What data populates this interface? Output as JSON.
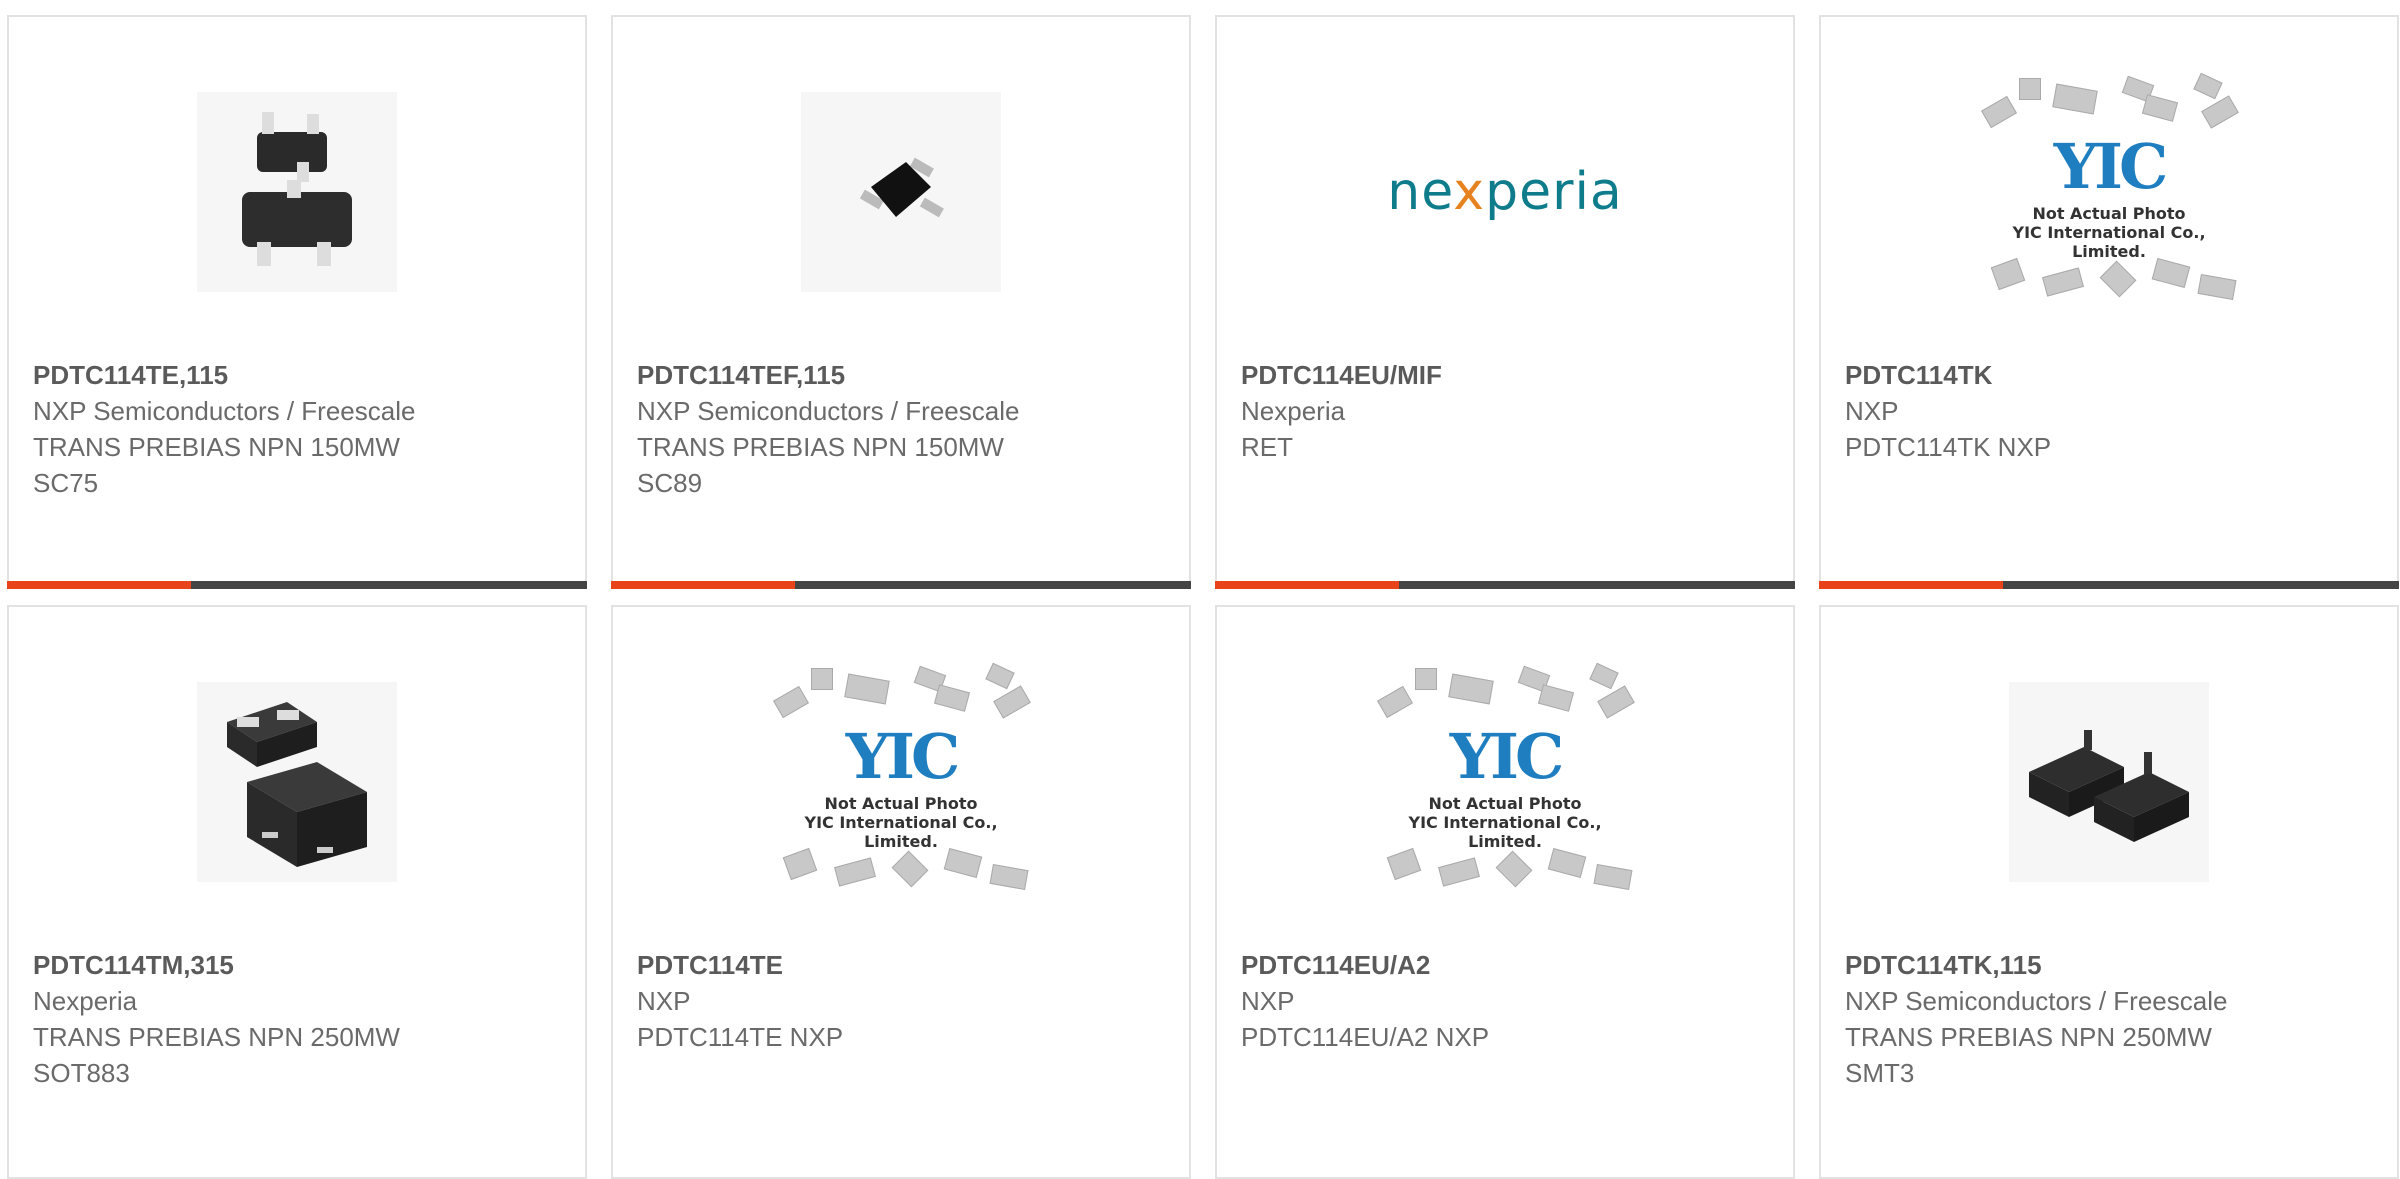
{
  "colors": {
    "accent": "#e8431b",
    "bar": "#444444",
    "border": "#e2e2e2"
  },
  "products": [
    {
      "part": "PDTC114TE,115",
      "maker": "NXP Semiconductors / Freescale",
      "desc": "TRANS PREBIAS NPN 150MW",
      "pkg": "SC75",
      "image": "component-photo"
    },
    {
      "part": "PDTC114TEF,115",
      "maker": "NXP Semiconductors / Freescale",
      "desc": "TRANS PREBIAS NPN 150MW",
      "pkg": "SC89",
      "image": "component-photo"
    },
    {
      "part": "PDTC114EU/MIF",
      "maker": "Nexperia",
      "desc": "RET",
      "pkg": "",
      "image": "nexperia-logo",
      "logo_text_a": "ne",
      "logo_text_x": "x",
      "logo_text_b": "peria"
    },
    {
      "part": "PDTC114TK",
      "maker": "NXP",
      "desc": "PDTC114TK NXP",
      "pkg": "",
      "image": "yic-placeholder"
    },
    {
      "part": "PDTC114TM,315",
      "maker": "Nexperia",
      "desc": "TRANS PREBIAS NPN 250MW",
      "pkg": "SOT883",
      "image": "component-photo"
    },
    {
      "part": "PDTC114TE",
      "maker": "NXP",
      "desc": "PDTC114TE NXP",
      "pkg": "",
      "image": "yic-placeholder"
    },
    {
      "part": "PDTC114EU/A2",
      "maker": "NXP",
      "desc": "PDTC114EU/A2 NXP",
      "pkg": "",
      "image": "yic-placeholder"
    },
    {
      "part": "PDTC114TK,115",
      "maker": "NXP Semiconductors / Freescale",
      "desc": "TRANS PREBIAS NPN 250MW",
      "pkg": "SMT3",
      "image": "component-photo"
    }
  ],
  "yic": {
    "logo": "YIC",
    "caption_1": "Not Actual Photo",
    "caption_2": "YIC International Co., Limited."
  }
}
